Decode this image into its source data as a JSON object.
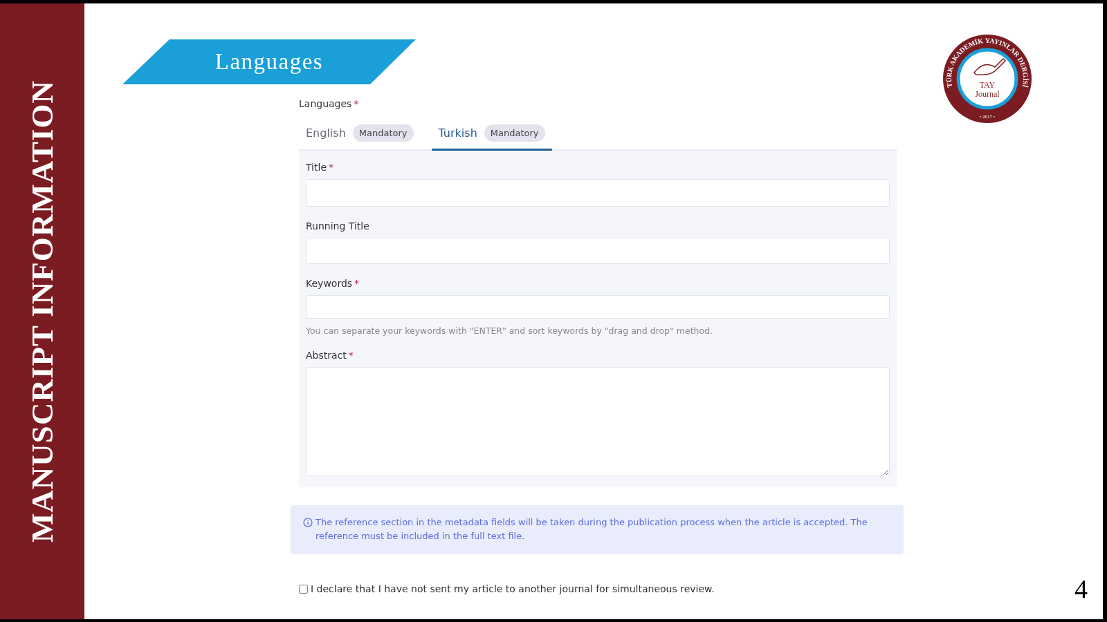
{
  "sidebar_title": "MANUSCRIPT INFORMATION",
  "banner": {
    "title": "Languages"
  },
  "logo": {
    "ring_text": "TÜRK AKADEMİK YAYINLAR DERGİSİ",
    "name": "TAY",
    "subtitle": "Journal",
    "year": "• 2017 •"
  },
  "form": {
    "label": "Languages",
    "required_mark": "*",
    "tabs": [
      {
        "label": "English",
        "badge": "Mandatory",
        "selected": false
      },
      {
        "label": "Turkish",
        "badge": "Mandatory",
        "selected": true
      }
    ],
    "fields": [
      {
        "kind": "input",
        "label": "Title",
        "required_mark": "*"
      },
      {
        "kind": "input",
        "label": "Running Title"
      },
      {
        "kind": "input",
        "label": "Keywords",
        "required_mark": "*",
        "hint": "You can separate your keywords with \"ENTER\" and sort keywords by \"drag and drop\" method."
      },
      {
        "kind": "textarea",
        "label": "Abstract",
        "required_mark": "*"
      }
    ]
  },
  "notice": "The reference section in the metadata fields will be taken during the publication process when the article is accepted. The reference must be included in the full text file.",
  "declaration": {
    "label": "I declare that I have not sent my article to another journal for simultaneous review.",
    "checked": false
  },
  "page_number": "4"
}
